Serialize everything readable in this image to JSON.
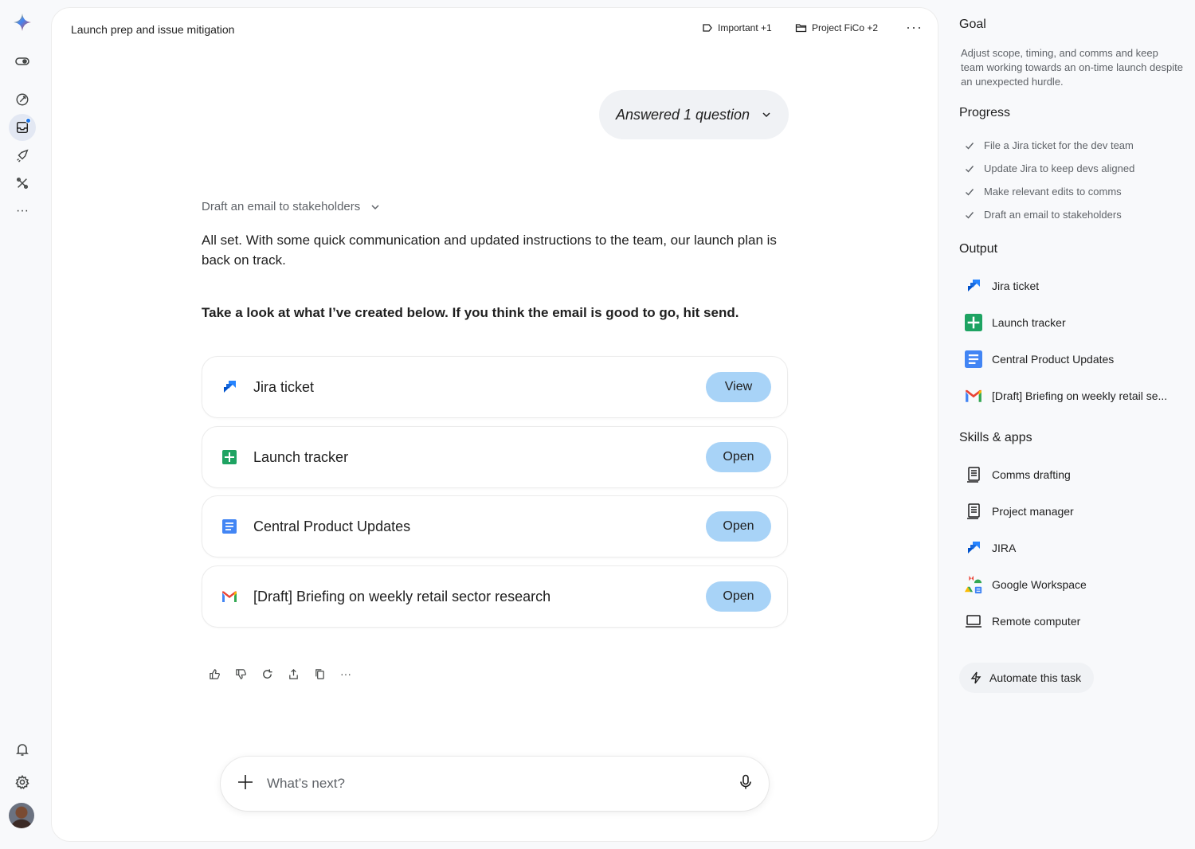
{
  "header": {
    "title": "Launch prep and issue mitigation",
    "label_chip": "Important +1",
    "project_chip": "Project FiCo +2",
    "more": "···"
  },
  "thread": {
    "answered_pill": "Answered 1 question",
    "step_label": "Draft an email to stakeholders",
    "paragraph_1": "All set. With some quick communication and updated instructions to the team, our launch plan is back on track.",
    "paragraph_2": "Take a look at what I’ve created below. If you think the email is good to go, hit send.",
    "cards": [
      {
        "label": "Jira ticket",
        "action": "View",
        "icon": "jira-icon"
      },
      {
        "label": "Launch tracker",
        "action": "Open",
        "icon": "sheets-icon"
      },
      {
        "label": "Central Product Updates",
        "action": "Open",
        "icon": "docs-icon"
      },
      {
        "label": "[Draft] Briefing on weekly retail sector research",
        "action": "Open",
        "icon": "gmail-icon"
      }
    ],
    "more_actions": "···"
  },
  "composer": {
    "placeholder": "What’s next?"
  },
  "panel": {
    "goal_heading": "Goal",
    "goal_text": "Adjust scope, timing, and comms and keep team working towards an on-time launch despite an unexpected hurdle.",
    "progress_heading": "Progress",
    "progress": [
      "File a Jira ticket for the dev team",
      "Update Jira to keep devs aligned",
      "Make relevant edits to comms",
      "Draft an email to stakeholders"
    ],
    "output_heading": "Output",
    "outputs": [
      {
        "label": "Jira ticket",
        "icon": "jira-icon"
      },
      {
        "label": "Launch tracker",
        "icon": "sheets-icon"
      },
      {
        "label": "Central Product Updates",
        "icon": "docs-icon"
      },
      {
        "label": "[Draft] Briefing on weekly retail se...",
        "icon": "gmail-icon"
      }
    ],
    "skills_heading": "Skills & apps",
    "skills": [
      {
        "label": "Comms drafting",
        "icon": "document-icon"
      },
      {
        "label": "Project manager",
        "icon": "document-icon"
      },
      {
        "label": "JIRA",
        "icon": "jira-icon"
      },
      {
        "label": "Google Workspace",
        "icon": "workspace-icon"
      },
      {
        "label": "Remote computer",
        "icon": "laptop-icon"
      }
    ],
    "automate_label": "Automate this task"
  },
  "colors": {
    "action_button": "#a8d3f7",
    "jira": "#2684ff",
    "sheets": "#1ea362",
    "docs": "#4285f4"
  }
}
